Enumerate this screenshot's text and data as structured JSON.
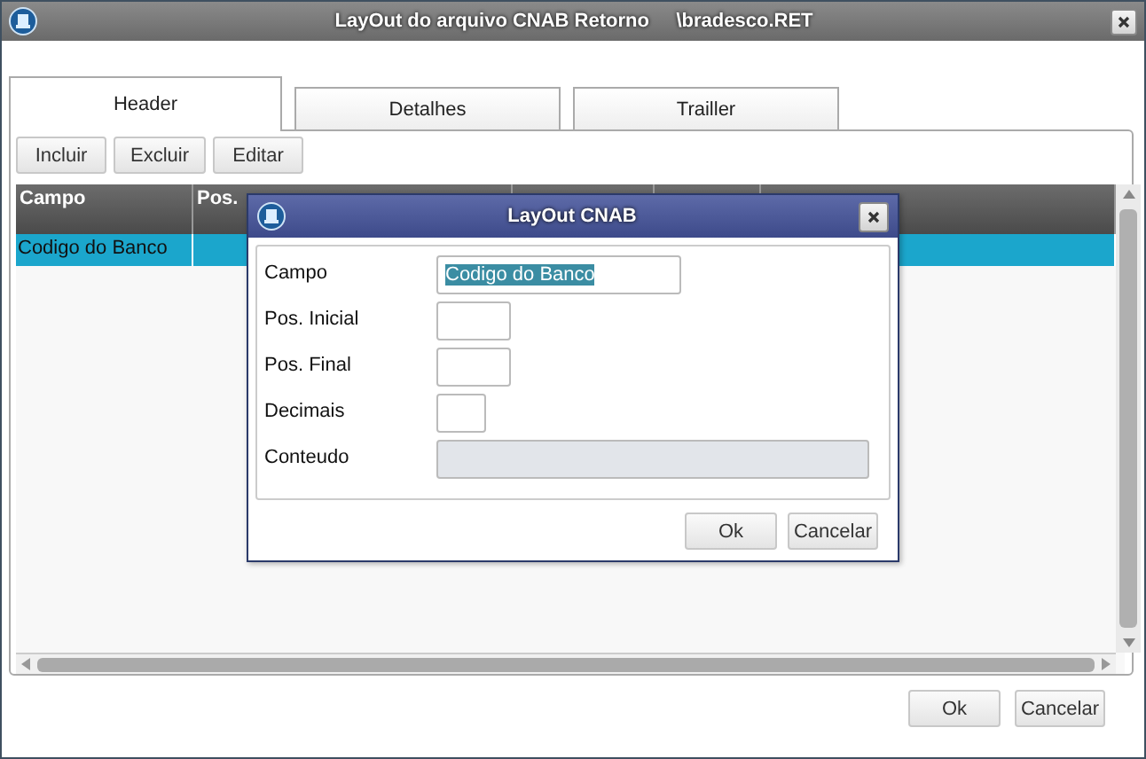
{
  "window": {
    "title": "LayOut do arquivo CNAB Retorno     \\bradesco.RET"
  },
  "tabs": [
    {
      "label": "Header",
      "selected": true
    },
    {
      "label": "Detalhes",
      "selected": false
    },
    {
      "label": "Trailler",
      "selected": false
    }
  ],
  "toolbar": [
    "Incluir",
    "Excluir",
    "Editar"
  ],
  "table": {
    "columns": [
      "Campo",
      "Pos."
    ],
    "rows": [
      {
        "cells": [
          "Codigo do Banco"
        ],
        "selected": true
      }
    ]
  },
  "dialog": {
    "title": "LayOut CNAB",
    "fields": [
      {
        "label": "Campo",
        "value": "Codigo do Banco",
        "disabled": false,
        "highlighted": true
      },
      {
        "label": "Pos. Inicial",
        "disabled": false
      },
      {
        "label": "Pos. Final",
        "disabled": false
      },
      {
        "label": "Decimais",
        "disabled": false
      },
      {
        "label": "Conteudo",
        "disabled": true
      }
    ],
    "buttons": [
      "Ok",
      "Cancelar"
    ]
  },
  "buttons": [
    "Ok",
    "Cancelar"
  ]
}
